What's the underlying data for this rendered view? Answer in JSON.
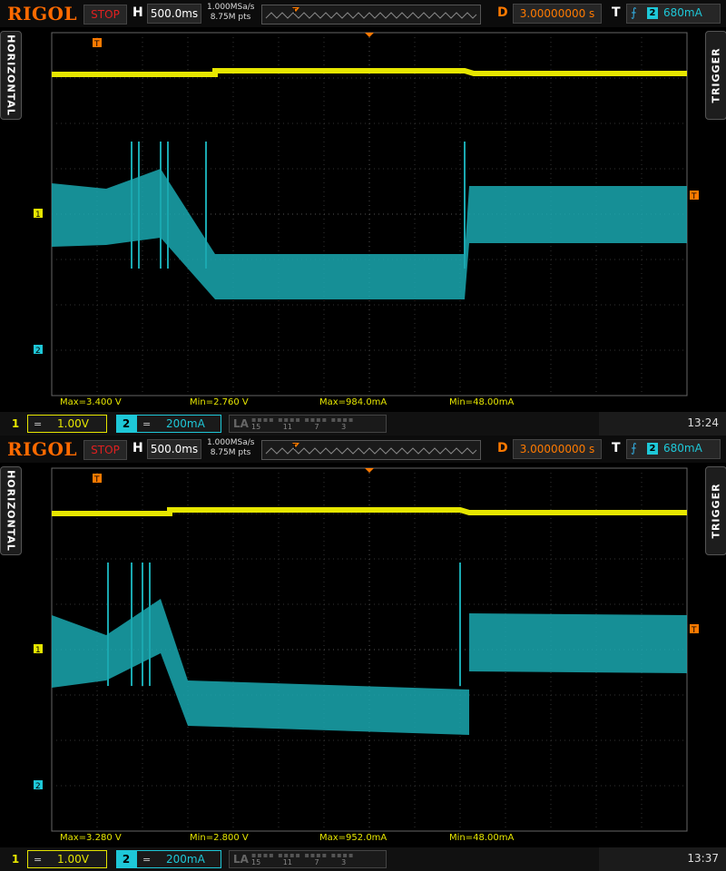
{
  "screens": [
    {
      "brand": "RIGOL",
      "run_state": "STOP",
      "h_label": "H",
      "timebase": "500.0ms",
      "sample_rate": "1.000MSa/s",
      "mem_depth": "8.75M pts",
      "trigger_marker": "T",
      "d_label": "D",
      "delay": "3.00000000 s",
      "t_label": "T",
      "trigger_source": "2",
      "trigger_level": "680mA",
      "side_left": "HORIZONTAL",
      "side_right": "TRIGGER",
      "ch1_marker": "1",
      "ch2_marker": "2",
      "stats": [
        "Max=3.400 V",
        "Min=2.760 V",
        "Max=984.0mA",
        "Min=48.00mA"
      ],
      "ch1": {
        "num": "1",
        "coupling": "=",
        "scale": "1.00V"
      },
      "ch2": {
        "num": "2",
        "coupling": "=",
        "scale": "200mA"
      },
      "la": {
        "label": "LA",
        "nums": "15 11 7 3"
      },
      "time": "13:24",
      "colors": {
        "ch1": "#e6e600",
        "ch2": "#1aa8b0"
      }
    },
    {
      "brand": "RIGOL",
      "run_state": "STOP",
      "h_label": "H",
      "timebase": "500.0ms",
      "sample_rate": "1.000MSa/s",
      "mem_depth": "8.75M pts",
      "trigger_marker": "T",
      "d_label": "D",
      "delay": "3.00000000 s",
      "t_label": "T",
      "trigger_source": "2",
      "trigger_level": "680mA",
      "side_left": "HORIZONTAL",
      "side_right": "TRIGGER",
      "ch1_marker": "1",
      "ch2_marker": "2",
      "stats": [
        "Max=3.280 V",
        "Min=2.800 V",
        "Max=952.0mA",
        "Min=48.00mA"
      ],
      "ch1": {
        "num": "1",
        "coupling": "=",
        "scale": "1.00V"
      },
      "ch2": {
        "num": "2",
        "coupling": "=",
        "scale": "200mA"
      },
      "la": {
        "label": "LA",
        "nums": "15 11 7 3"
      },
      "time": "13:37",
      "colors": {
        "ch1": "#e6e600",
        "ch2": "#1aa8b0"
      }
    }
  ]
}
